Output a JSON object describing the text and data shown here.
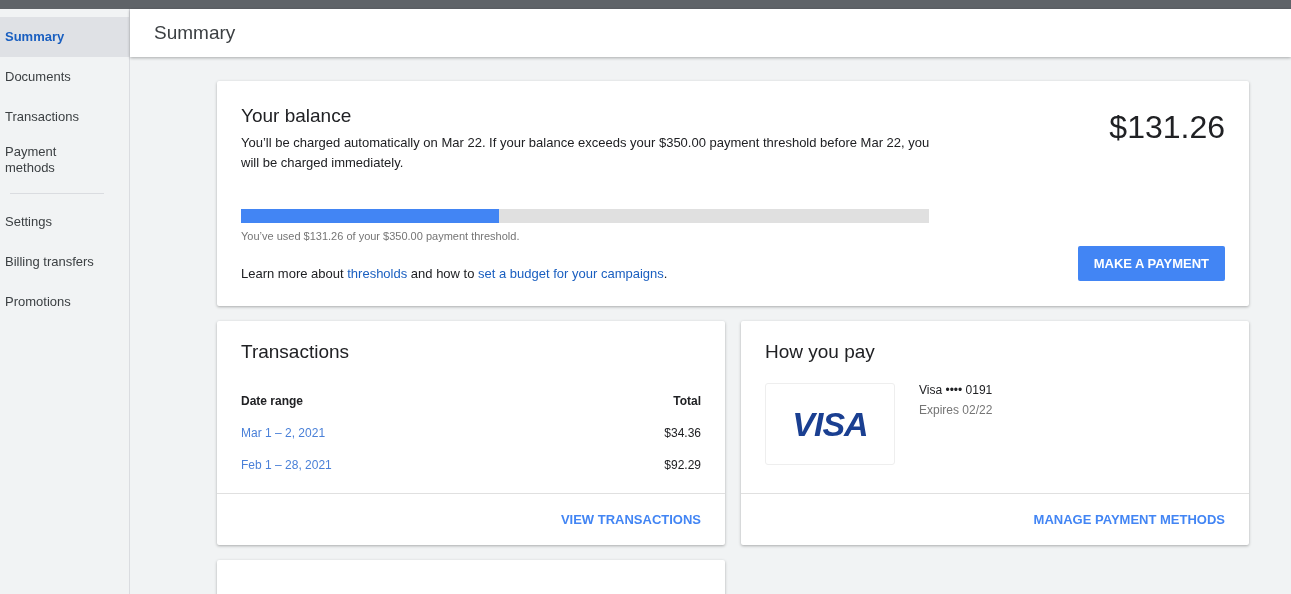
{
  "sidebar": {
    "items": [
      {
        "label": "Summary",
        "selected": true
      },
      {
        "label": "Documents",
        "selected": false
      },
      {
        "label": "Transactions",
        "selected": false
      },
      {
        "label": "Payment methods",
        "selected": false,
        "divider_after": true
      },
      {
        "label": "Settings",
        "selected": false
      },
      {
        "label": "Billing transfers",
        "selected": false
      },
      {
        "label": "Promotions",
        "selected": false
      }
    ]
  },
  "header": {
    "title": "Summary"
  },
  "balance": {
    "title": "Your balance",
    "description": "You’ll be charged automatically on Mar 22. If your balance exceeds your $350.00 payment threshold before Mar 22, you will be charged immediately.",
    "amount": "$131.26",
    "progress": {
      "level": 0.375,
      "caption": "You’ve used $131.26 of your $350.00 payment threshold."
    },
    "learn_more": [
      {
        "kind": "text",
        "text": "Learn more about "
      },
      {
        "kind": "link",
        "text": "thresholds"
      },
      {
        "kind": "text",
        "text": " and how to "
      },
      {
        "kind": "link",
        "text": "set a budget for your campaigns"
      },
      {
        "kind": "text",
        "text": "."
      }
    ],
    "button": "MAKE A PAYMENT"
  },
  "transactions": {
    "title": "Transactions",
    "columns": [
      "Date range",
      "Total"
    ],
    "rows": [
      {
        "date_range": "Mar 1 – 2, 2021",
        "total": "$34.36"
      },
      {
        "date_range": "Feb 1 – 28, 2021",
        "total": "$92.29"
      }
    ],
    "action": "VIEW TRANSACTIONS"
  },
  "how_you_pay": {
    "title": "How you pay",
    "card_logo": "VISA",
    "card_name": "Visa •••• 0191",
    "expires": "Expires 02/22",
    "action": "MANAGE PAYMENT METHODS"
  }
}
